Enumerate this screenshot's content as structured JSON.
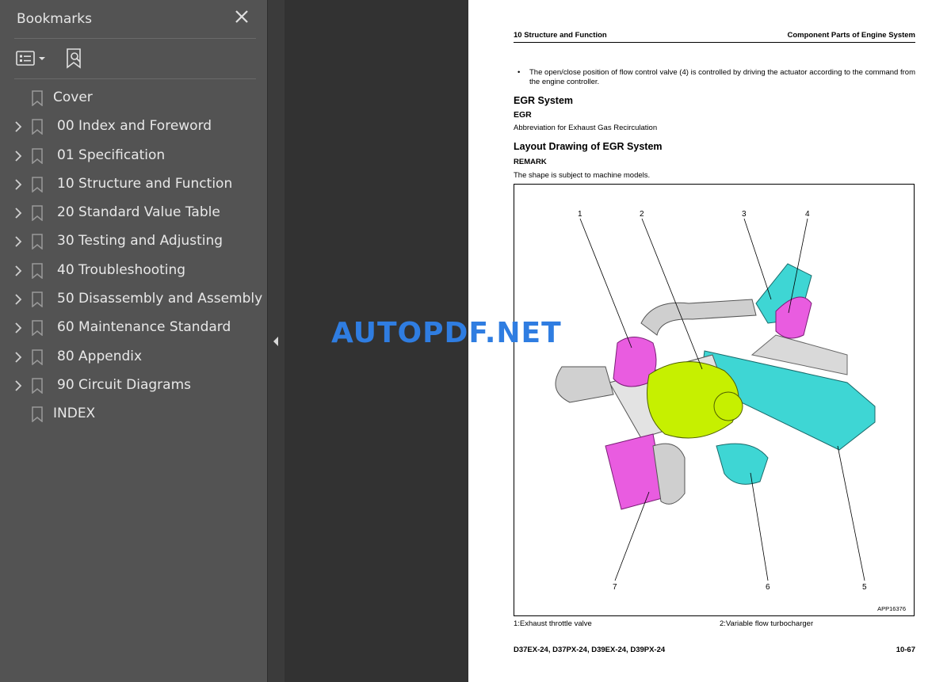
{
  "sidebar": {
    "title": "Bookmarks",
    "items": [
      {
        "label": "Cover",
        "expandable": false
      },
      {
        "label": "00 Index and Foreword",
        "expandable": true
      },
      {
        "label": "01 Specification",
        "expandable": true
      },
      {
        "label": "10 Structure and Function",
        "expandable": true
      },
      {
        "label": "20 Standard Value Table",
        "expandable": true
      },
      {
        "label": "30 Testing and Adjusting",
        "expandable": true
      },
      {
        "label": "40 Troubleshooting",
        "expandable": true
      },
      {
        "label": "50 Disassembly and Assembly",
        "expandable": true
      },
      {
        "label": "60 Maintenance Standard",
        "expandable": true
      },
      {
        "label": "80 Appendix",
        "expandable": true
      },
      {
        "label": "90 Circuit Diagrams",
        "expandable": true
      },
      {
        "label": "INDEX",
        "expandable": false
      }
    ]
  },
  "page": {
    "header_left": "10 Structure and Function",
    "header_right": "Component Parts of Engine System",
    "bullet_text": "The open/close position of flow control valve (4) is controlled by driving the actuator according to the command from the engine controller.",
    "heading_egr": "EGR System",
    "sub_egr": "EGR",
    "abbreviation": "Abbreviation for Exhaust Gas Recirculation",
    "heading_layout": "Layout Drawing of EGR System",
    "remark": "REMARK",
    "shape_note": "The shape is subject to machine models.",
    "figure_code": "APP16376",
    "callouts": [
      "1",
      "2",
      "3",
      "4",
      "5",
      "6",
      "7"
    ],
    "caption_1": "1:Exhaust throttle valve",
    "caption_2": "2:Variable flow turbocharger",
    "footer_models": "D37EX-24, D37PX-24, D39EX-24, D39PX-24",
    "footer_page": "10-67"
  },
  "watermark": "AUTOPDF.NET",
  "colors": {
    "sidebar_bg": "#535353",
    "viewer_bg": "#323232",
    "watermark": "#2f7de1",
    "part_magenta": "#e95ce0",
    "part_lime": "#c6f000",
    "part_cyan": "#3ed6d4"
  },
  "icons": {
    "close": "close-icon",
    "options": "list-options-icon",
    "find": "bookmark-search-icon",
    "chevron": "chevron-right-icon",
    "bookmark": "bookmark-flag-icon",
    "collapse": "collapse-left-icon"
  }
}
